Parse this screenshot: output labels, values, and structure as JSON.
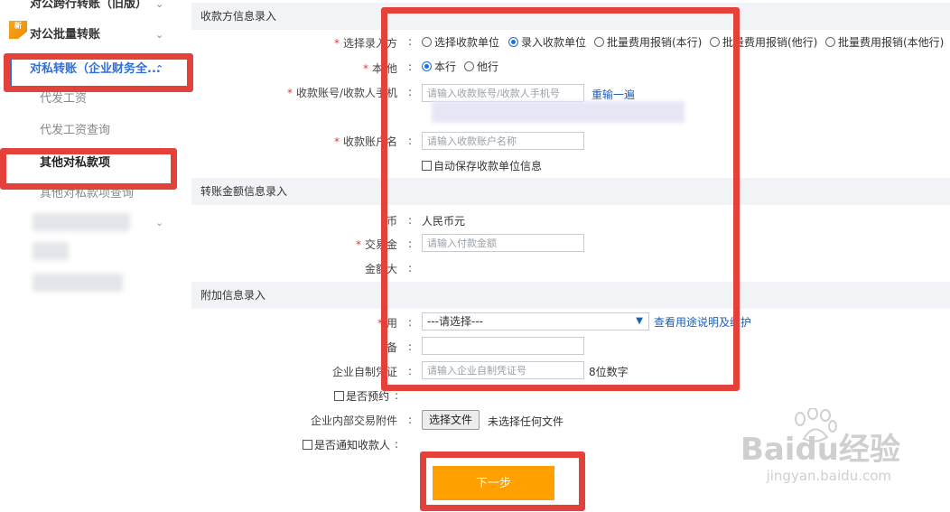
{
  "sidebar": {
    "items": [
      {
        "label": "对公跨行转账（旧版）"
      },
      {
        "label": "对公批量转账",
        "badge": "新"
      },
      {
        "label": "对私转账（企业财务全..."
      },
      {
        "label": "代发工资"
      },
      {
        "label": "代发工资查询"
      },
      {
        "label": "其他对私款项"
      },
      {
        "label": "其他对私款项查询"
      }
    ]
  },
  "sections": {
    "payee": "收款方信息录入",
    "amount": "转账金额信息录入",
    "extra": "附加信息录入"
  },
  "payee": {
    "mode_label": "选择录入方",
    "mode_options": [
      "选择收款单位",
      "录入收款单位",
      "批量费用报销(本行)",
      "批量费用报销(他行)",
      "批量费用报销(本他行)"
    ],
    "mode_selected": 1,
    "bank_label": "本/他",
    "bank_options": [
      "本行",
      "他行"
    ],
    "bank_selected": 0,
    "account_label": "收款账号/收款人手机",
    "account_placeholder": "请输入收款账号/收款人手机号",
    "account_link": "重输一遍",
    "name_label": "收款账户名",
    "name_placeholder": "请输入收款账户名称",
    "autosave_label": "自动保存收款单位信息"
  },
  "amount": {
    "currency_label": "币",
    "currency_value": "人民币元",
    "amount_label": "交易金",
    "amount_placeholder": "请输入付款金额",
    "uppercase_label": "金额大"
  },
  "extra": {
    "purpose_label": "用",
    "purpose_value": "---请选择---",
    "purpose_link": "查看用途说明及维护",
    "remark_label": "备",
    "voucher_label": "企业自制凭证",
    "voucher_placeholder": "请输入企业自制凭证号",
    "voucher_hint": "8位数字",
    "reserve_label": "是否预约",
    "attach_label": "企业内部交易附件",
    "attach_button": "选择文件",
    "attach_status": "未选择任何文件",
    "notify_label": "是否通知收款人"
  },
  "next_button": "下一步",
  "watermark": {
    "main": "Baidu经验",
    "sub": "jingyan.baidu.com"
  },
  "colors": {
    "accent": "#2f6fd6",
    "required": "#e23b3b",
    "highlight_box": "#e3413a",
    "next_button": "#ff9f00"
  }
}
